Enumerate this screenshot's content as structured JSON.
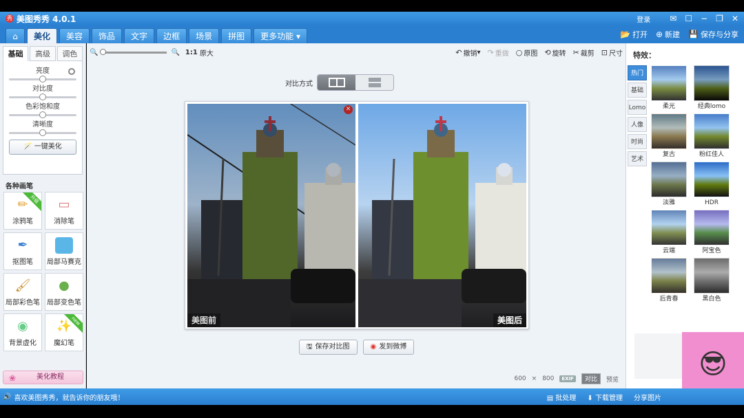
{
  "titlebar": {
    "app_title": "美图秀秀 4.0.1",
    "login": "登录",
    "minimize": "−",
    "restore": "❐",
    "close": "✕",
    "chat": "☐"
  },
  "nav": {
    "tabs": [
      "美化",
      "美容",
      "饰品",
      "文字",
      "边框",
      "场景",
      "拼图",
      "更多功能"
    ],
    "active": "美化",
    "open": "打开",
    "new": "新建",
    "save_share": "保存与分享"
  },
  "left_panel": {
    "tabs": [
      "基础",
      "高级",
      "调色"
    ],
    "sliders": [
      {
        "label": "亮度",
        "value": 0.5
      },
      {
        "label": "对比度",
        "value": 0.5
      },
      {
        "label": "色彩饱和度",
        "value": 0.5
      },
      {
        "label": "清晰度",
        "value": 0.5
      }
    ],
    "onekey": "一键美化",
    "brushes_title": "各种画笔",
    "brushes": [
      {
        "label": "涂鸦笔",
        "badge": "升级"
      },
      {
        "label": "消除笔",
        "badge": ""
      },
      {
        "label": "抠图笔",
        "badge": ""
      },
      {
        "label": "局部马赛克",
        "badge": ""
      },
      {
        "label": "局部彩色笔",
        "badge": ""
      },
      {
        "label": "局部变色笔",
        "badge": ""
      },
      {
        "label": "背景虚化",
        "badge": ""
      },
      {
        "label": "魔幻笔",
        "badge": "new"
      }
    ],
    "tutorial": "美化教程"
  },
  "toolbar": {
    "ratio": "1:1",
    "original_size": "原大",
    "undo": "撤销",
    "redo": "重做",
    "original": "原图",
    "rotate": "旋转",
    "crop": "裁剪",
    "resize": "尺寸"
  },
  "compare": {
    "label": "对比方式"
  },
  "photos": {
    "before": "美图前",
    "after": "美图后"
  },
  "actions": {
    "save_compare": "保存对比图",
    "weibo": "发到微博"
  },
  "canvas_bottom": {
    "width": "600",
    "x": "×",
    "height": "800",
    "exif": "EXIF",
    "compare": "对比",
    "preview": "预览"
  },
  "right_panel": {
    "title": "特效：",
    "tabs": [
      "热门",
      "基础",
      "Lomo",
      "人像",
      "时尚",
      "艺术"
    ],
    "effects": [
      "柔光",
      "经典lomo",
      "复古",
      "粉红佳人",
      "淡雅",
      "HDR",
      "云端",
      "阿宝色",
      "后青春",
      "黑白色"
    ]
  },
  "statusbar": {
    "message": "喜欢美图秀秀，就告诉你的朋友哦！",
    "batch": "批处理",
    "download": "下载管理",
    "share": "分享图片"
  }
}
